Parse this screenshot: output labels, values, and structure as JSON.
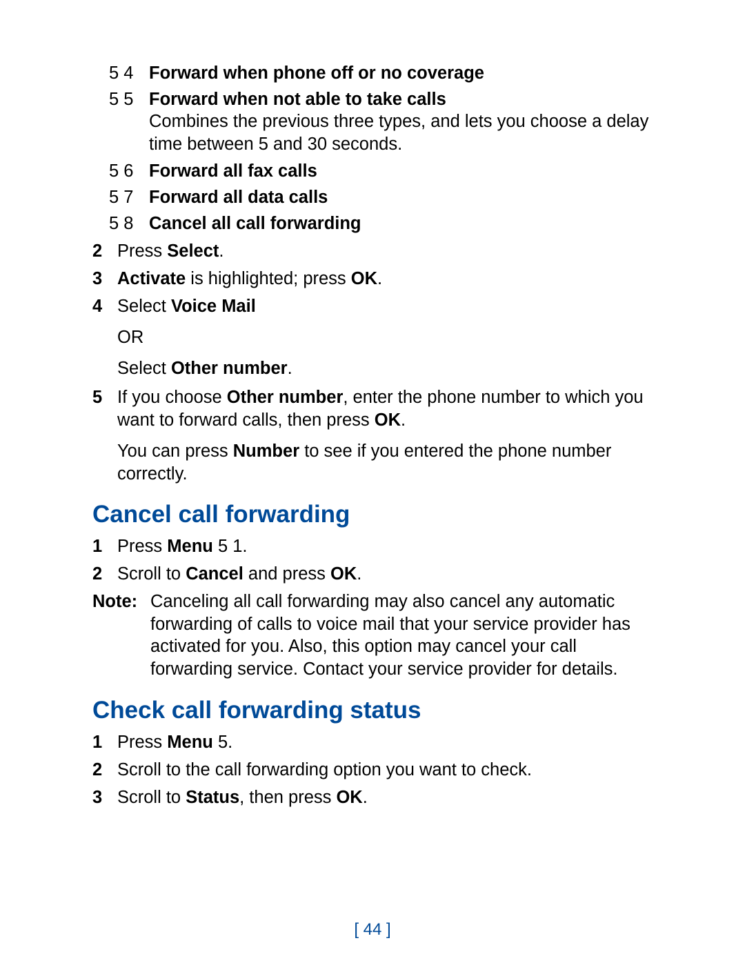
{
  "enums": {
    "e1": {
      "code": "5 4",
      "title": "Forward when phone off or no coverage"
    },
    "e2": {
      "code": "5 5",
      "title": "Forward when not able to take calls",
      "desc": "Combines the previous three types, and lets you choose a delay time between 5 and 30 seconds."
    },
    "e3": {
      "code": "5 6",
      "title": "Forward all fax calls"
    },
    "e4": {
      "code": "5 7",
      "title": "Forward all data calls"
    },
    "e5": {
      "code": "5 8",
      "title": "Cancel all call forwarding"
    }
  },
  "stepsA": {
    "s2": {
      "num": "2",
      "t1": "Press ",
      "b1": "Select",
      "t2": "."
    },
    "s3": {
      "num": "3",
      "b1": "Activate",
      "t1": " is highlighted; press ",
      "b2": "OK",
      "t2": "."
    },
    "s4": {
      "num": "4",
      "t1": "Select ",
      "b1": "Voice Mail",
      "or": "OR",
      "t2": "Select ",
      "b2": "Other number",
      "t3": "."
    },
    "s5": {
      "num": "5",
      "p1a": "If you choose ",
      "p1b": "Other number",
      "p1c": ", enter the phone number to which you want to forward calls, then press ",
      "p1d": "OK",
      "p1e": ".",
      "p2a": "You can press ",
      "p2b": "Number",
      "p2c": " to see if you entered the phone number correctly."
    }
  },
  "h1": "Cancel call forwarding",
  "stepsB": {
    "s1": {
      "num": "1",
      "t1": "Press ",
      "b1": "Menu",
      "t2": " 5 1."
    },
    "s2": {
      "num": "2",
      "t1": "Scroll to ",
      "b1": "Cancel",
      "t2": " and press ",
      "b2": "OK",
      "t3": "."
    }
  },
  "note": {
    "label": "Note:",
    "body": "Canceling all call forwarding may also cancel any automatic forwarding of calls to voice mail that your service provider has activated for you. Also, this option may cancel your call forwarding service. Contact your service provider for details."
  },
  "h2": "Check call forwarding status",
  "stepsC": {
    "s1": {
      "num": "1",
      "t1": "Press ",
      "b1": "Menu",
      "t2": " 5."
    },
    "s2": {
      "num": "2",
      "t1": "Scroll to the call forwarding option you want to check."
    },
    "s3": {
      "num": "3",
      "t1": "Scroll to ",
      "b1": "Status",
      "t2": ", then press ",
      "b2": "OK",
      "t3": "."
    }
  },
  "pageNumber": "[ 44 ]"
}
